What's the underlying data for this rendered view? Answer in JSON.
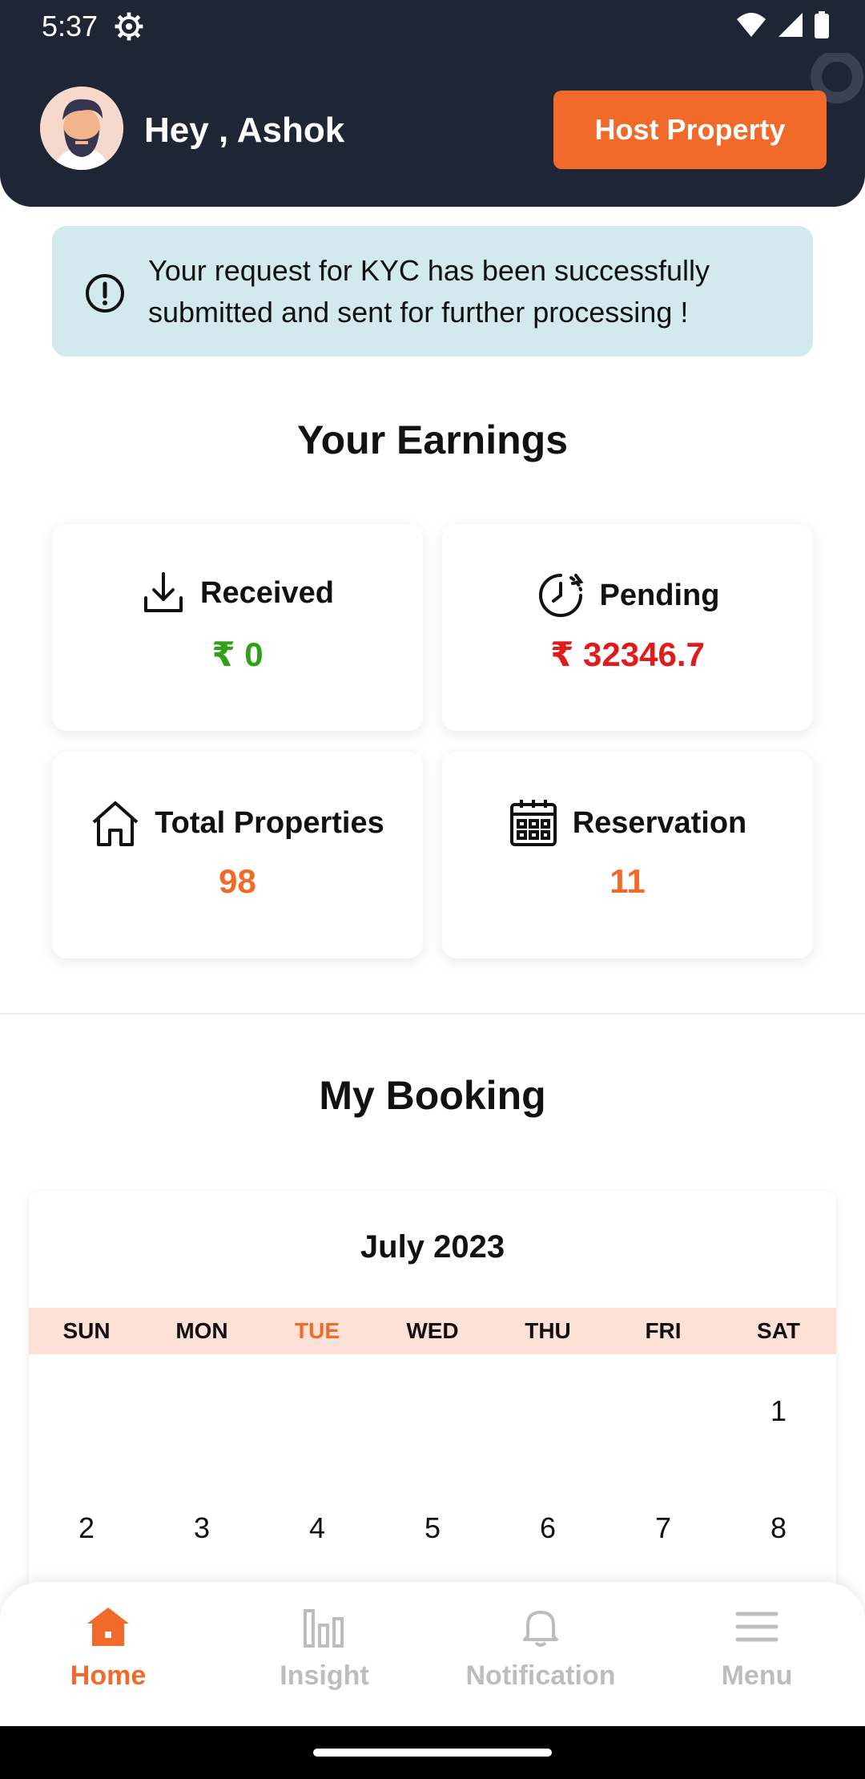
{
  "status_bar": {
    "time": "5:37"
  },
  "header": {
    "greeting": "Hey , Ashok",
    "host_button": "Host Property"
  },
  "kyc_notice": {
    "message": "Your request for KYC has been successfully submitted and sent for further processing !"
  },
  "earnings": {
    "title": "Your Earnings",
    "cards": [
      {
        "label": "Received",
        "value": "₹ 0"
      },
      {
        "label": "Pending",
        "value": "₹ 32346.7"
      },
      {
        "label": "Total Properties",
        "value": "98"
      },
      {
        "label": "Reservation",
        "value": "11"
      }
    ]
  },
  "booking": {
    "title": "My Booking",
    "calendar": {
      "month_label": "July 2023",
      "weekdays": [
        "SUN",
        "MON",
        "TUE",
        "WED",
        "THU",
        "FRI",
        "SAT"
      ],
      "highlight_weekday": "TUE",
      "weeks": [
        [
          "",
          "",
          "",
          "",
          "",
          "",
          "1"
        ],
        [
          "2",
          "3",
          "4",
          "5",
          "6",
          "7",
          "8"
        ]
      ]
    }
  },
  "bottom_nav": {
    "items": [
      {
        "label": "Home",
        "icon": "home-icon",
        "active": true
      },
      {
        "label": "Insight",
        "icon": "bar-chart-icon",
        "active": false
      },
      {
        "label": "Notification",
        "icon": "bell-icon",
        "active": false
      },
      {
        "label": "Menu",
        "icon": "menu-icon",
        "active": false
      }
    ]
  },
  "colors": {
    "accent": "#f26a2a",
    "header_bg": "#1e2535",
    "received": "#2ea318",
    "pending": "#e01b1b"
  }
}
